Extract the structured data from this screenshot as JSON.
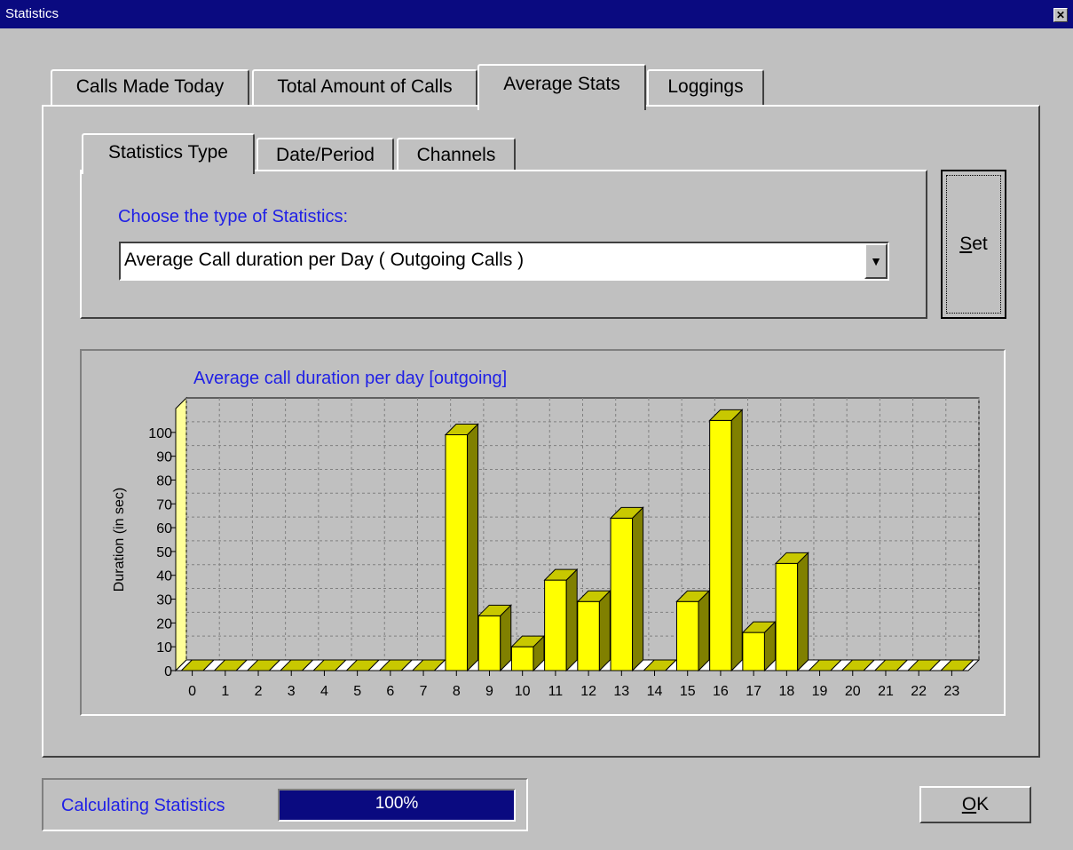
{
  "window": {
    "title": "Statistics",
    "close_glyph": "✕"
  },
  "main_tabs": [
    "Calls Made Today",
    "Total Amount of Calls",
    "Average Stats",
    "Loggings"
  ],
  "active_main_tab": "Average Stats",
  "sub_tabs": [
    "Statistics Type",
    "Date/Period",
    "Channels"
  ],
  "active_sub_tab": "Statistics Type",
  "statistics_type": {
    "label": "Choose the type of Statistics:",
    "selected": "Average Call duration per Day ( Outgoing Calls )",
    "dropdown_glyph": "▼"
  },
  "set_button": {
    "accel": "S",
    "rest": "et"
  },
  "ok_button": {
    "accel": "O",
    "rest": "K"
  },
  "progress": {
    "label": "Calculating Statistics",
    "text": "100%",
    "value": 1.0
  },
  "colors": {
    "bar_front": "#ffff00",
    "bar_top": "#c8c800",
    "bar_side": "#808000",
    "accent_text": "#1f1fe6",
    "title_bar": "#0a0a80",
    "progress_fill": "#0a0a80"
  },
  "chart_data": {
    "type": "bar",
    "title": "Average call duration per day [outgoing]",
    "xlabel": "",
    "ylabel": "Duration (in sec)",
    "categories": [
      "0",
      "1",
      "2",
      "3",
      "4",
      "5",
      "6",
      "7",
      "8",
      "9",
      "10",
      "11",
      "12",
      "13",
      "14",
      "15",
      "16",
      "17",
      "18",
      "19",
      "20",
      "21",
      "22",
      "23"
    ],
    "values": [
      0,
      0,
      0,
      0,
      0,
      0,
      0,
      0,
      99,
      23,
      10,
      38,
      29,
      64,
      0,
      29,
      105,
      16,
      45,
      0,
      0,
      0,
      0,
      0
    ],
    "yticks": [
      0,
      10,
      20,
      30,
      40,
      50,
      60,
      70,
      80,
      90,
      100
    ],
    "ylim": [
      0,
      110
    ],
    "grid": true,
    "three_d": true
  }
}
